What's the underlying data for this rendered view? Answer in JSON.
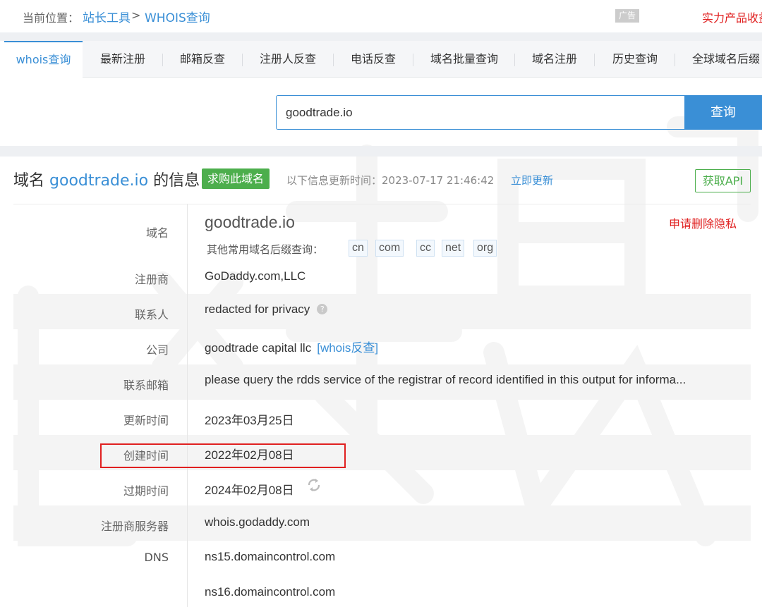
{
  "breadcrumb": {
    "label": "当前位置：",
    "home": "站长工具",
    "separator": ">",
    "current": "WHOIS查询"
  },
  "ad": {
    "badge": "广告",
    "text": "实力产品收益"
  },
  "tabs": [
    {
      "label": "whois查询",
      "active": true
    },
    {
      "label": "最新注册"
    },
    {
      "label": "邮箱反查"
    },
    {
      "label": "注册人反查"
    },
    {
      "label": "电话反查"
    },
    {
      "label": "域名批量查询"
    },
    {
      "label": "域名注册"
    },
    {
      "label": "历史查询"
    },
    {
      "label": "全球域名后缀"
    }
  ],
  "search": {
    "value": "goodtrade.io",
    "button": "查询"
  },
  "heading": {
    "prefix": "域名",
    "domain": "goodtrade.io",
    "suffix": "的信息",
    "buy_badge": "求购此域名",
    "update_text": "以下信息更新时间：2023-07-17 21:46:42",
    "update_link": "立即更新",
    "api_button": "获取API"
  },
  "info": {
    "domain_label": "域名",
    "domain_value": "goodtrade.io",
    "privacy_link": "申请删除隐私",
    "suffix_label": "其他常用域名后缀查询：",
    "suffixes": [
      "cn",
      "com",
      "cc",
      "net",
      "org"
    ],
    "registrar_label": "注册商",
    "registrar_value": "GoDaddy.com,LLC",
    "contact_label": "联系人",
    "contact_value": "redacted for privacy",
    "help_glyph": "?",
    "company_label": "公司",
    "company_value": "goodtrade capital llc",
    "company_link": "[whois反查]",
    "email_label": "联系邮箱",
    "email_value": "please query the rdds service of the registrar of record identified in this output for informa...",
    "updated_label": "更新时间",
    "updated_value": "2023年03月25日",
    "created_label": "创建时间",
    "created_value": "2022年02月08日",
    "expires_label": "过期时间",
    "expires_value": "2024年02月08日",
    "server_label": "注册商服务器",
    "server_value": "whois.godaddy.com",
    "dns_label": "DNS",
    "dns_values": [
      "ns15.domaincontrol.com",
      "ns16.domaincontrol.com"
    ]
  },
  "colors": {
    "accent": "#3a8fd6",
    "green": "#4cae4c",
    "red": "#e02020"
  }
}
